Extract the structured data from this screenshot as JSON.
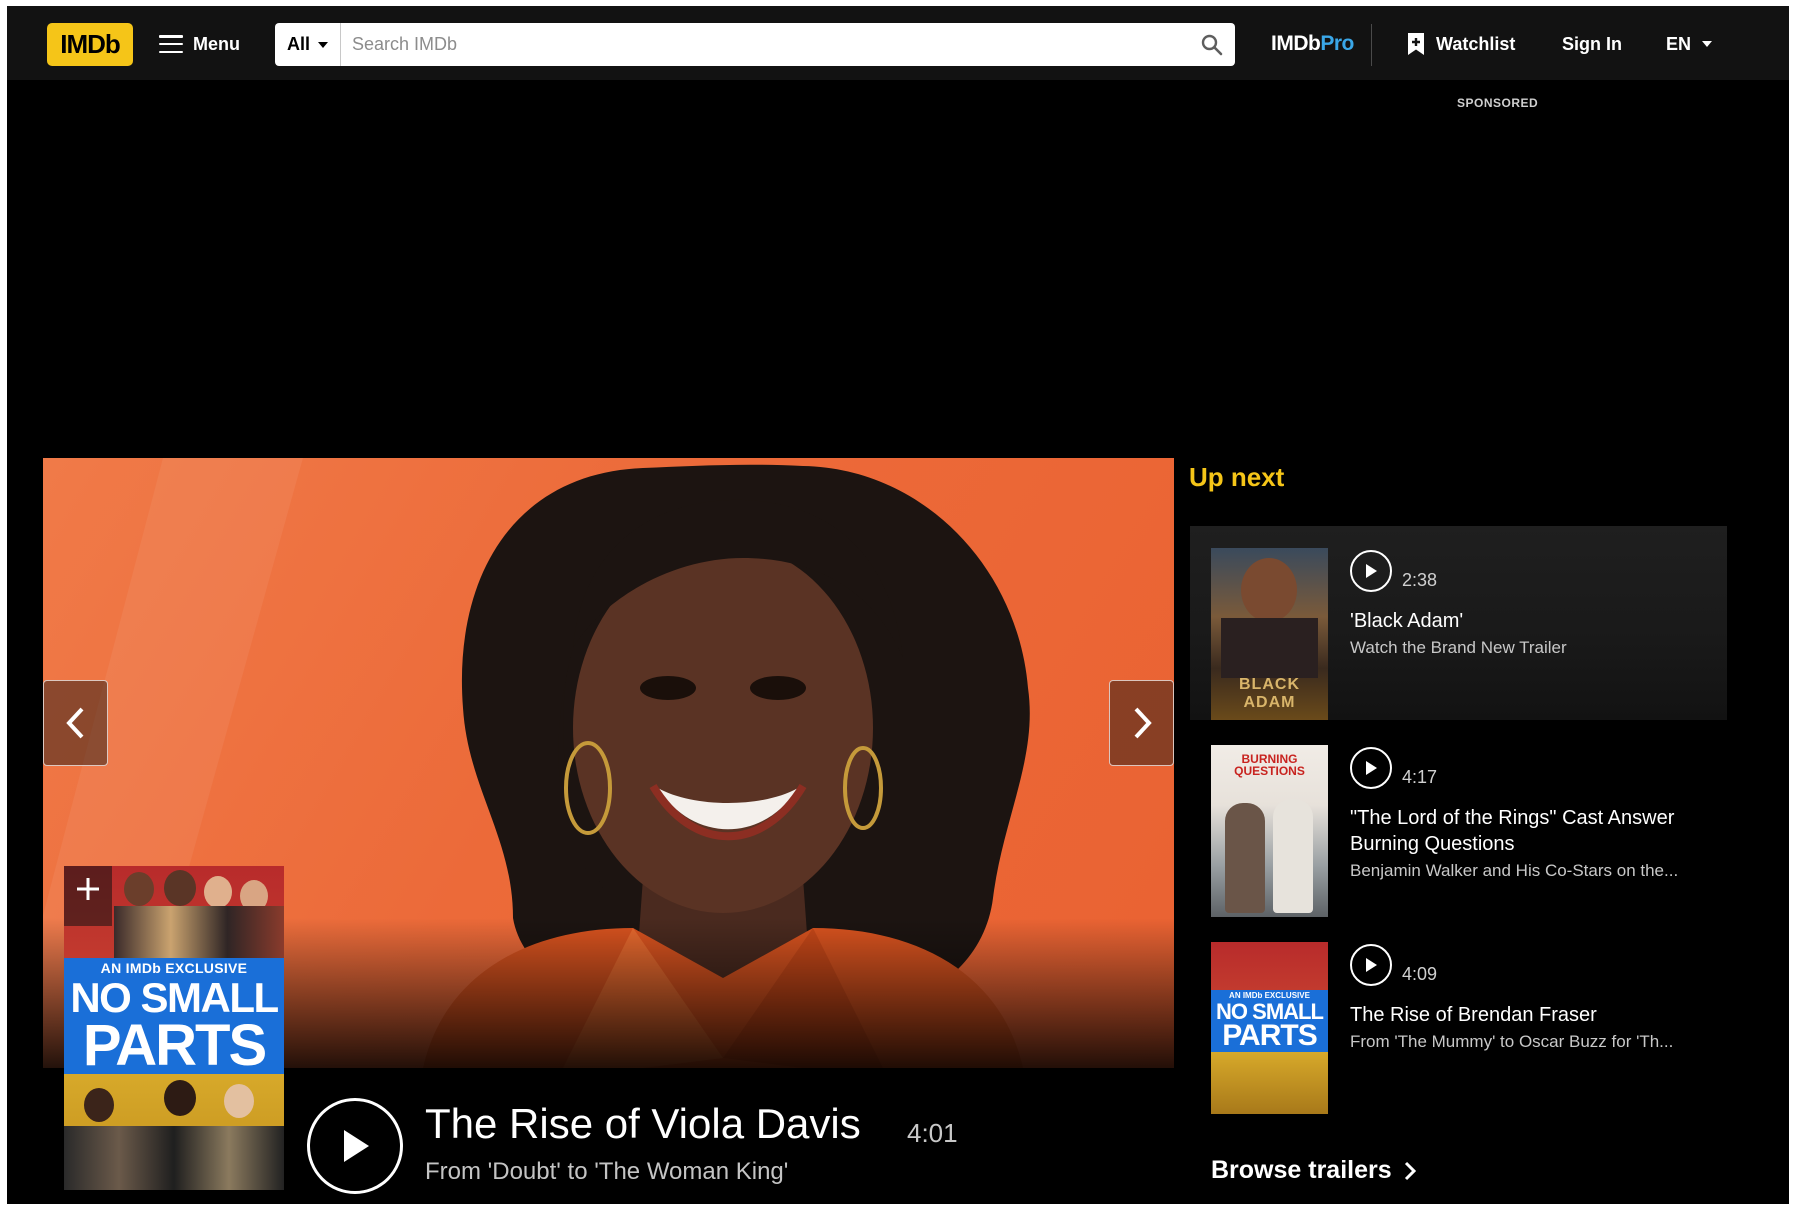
{
  "navbar": {
    "logo_text": "IMDb",
    "menu_label": "Menu",
    "search_category": "All",
    "search_placeholder": "Search IMDb",
    "imdbpro_imdb": "IMDb",
    "imdbpro_pro": "Pro",
    "watchlist_label": "Watchlist",
    "signin_label": "Sign In",
    "language": "EN"
  },
  "ad": {
    "sponsored_label": "SPONSORED"
  },
  "hero": {
    "title": "The Rise of Viola Davis",
    "subtitle": "From 'Doubt' to 'The Woman King'",
    "duration": "4:01",
    "poster": {
      "exclusive_label": "AN IMDb EXCLUSIVE",
      "line1": "NO SMALL",
      "line2": "PARTS"
    }
  },
  "up_next": {
    "heading": "Up next",
    "items": [
      {
        "duration": "2:38",
        "title": "'Black Adam'",
        "description": "Watch the Brand New Trailer",
        "thumb_text": "BLACK ADAM"
      },
      {
        "duration": "4:17",
        "title": "\"The Lord of the Rings\" Cast Answer Burning Questions",
        "description": "Benjamin Walker and His Co-Stars on the...",
        "thumb_text": "BURNING QUESTIONS"
      },
      {
        "duration": "4:09",
        "title": "The Rise of Brendan Fraser",
        "description": "From 'The Mummy' to Oscar Buzz for 'Th...",
        "thumb_exclusive": "AN IMDb EXCLUSIVE",
        "thumb_line1": "NO SMALL",
        "thumb_line2": "PARTS"
      }
    ],
    "browse_label": "Browse trailers"
  },
  "colors": {
    "imdb_yellow": "#f5c518",
    "hero_orange": "#ec6a39",
    "pro_blue": "#3aa7e8"
  }
}
